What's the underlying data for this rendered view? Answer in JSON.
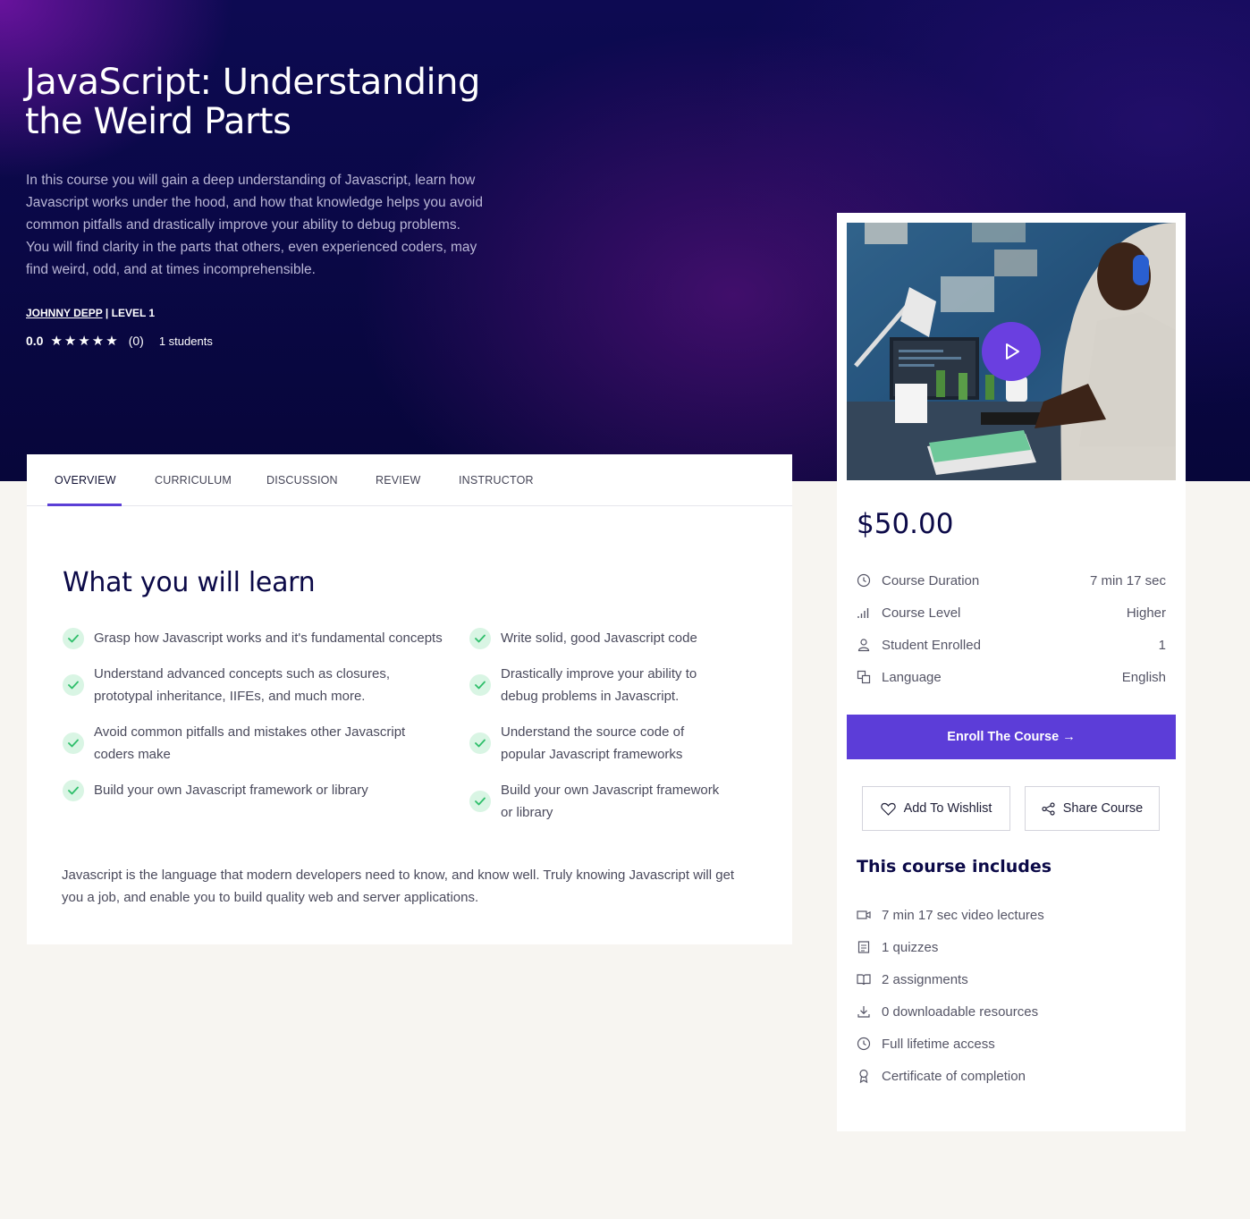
{
  "course": {
    "title": "JavaScript: Understanding the Weird Parts",
    "description": "In this course you will gain a deep understanding of Javascript, learn how Javascript works under the hood, and how that knowledge helps you avoid common pitfalls and drastically improve your ability to debug problems. You will find clarity in the parts that others, even experienced coders, may find weird, odd, and at times incomprehensible.",
    "author": "JOHNNY DEPP",
    "separator": " | ",
    "level": "LEVEL 1",
    "rating": "0.0",
    "stars": "★★★★★",
    "rating_count": "(0)",
    "students": "1 students"
  },
  "tabs": [
    "OVERVIEW",
    "CURRICULUM",
    "DISCUSSION",
    "REVIEW",
    "INSTRUCTOR"
  ],
  "learn": {
    "title": "What you will learn",
    "items": [
      "Grasp how Javascript works and it's fundamental concepts",
      "Write solid, good Javascript code",
      "Understand advanced concepts such as closures, prototypal inheritance, IIFEs, and much more.",
      "Drastically improve your ability to debug problems in Javascript.",
      "Avoid common pitfalls and mistakes other Javascript coders make",
      "Understand the source code of popular Javascript frameworks",
      "Build your own Javascript framework or library",
      "Build your own Javascript framework or library"
    ],
    "footer": "Javascript is the language that modern developers need to know, and know well. Truly knowing Javascript will get you a job, and enable you to build quality web and server applications."
  },
  "sidebar": {
    "price": "$50.00",
    "info": [
      {
        "label": "Course Duration",
        "value": "7 min 17 sec",
        "icon": "clock-icon"
      },
      {
        "label": "Course Level",
        "value": "Higher",
        "icon": "level-bars-icon"
      },
      {
        "label": "Student Enrolled",
        "value": "1",
        "icon": "students-icon"
      },
      {
        "label": "Language",
        "value": "English",
        "icon": "language-icon"
      }
    ],
    "enroll_label": "Enroll The Course →",
    "wishlist_label": "Add To Wishlist",
    "share_label": "Share Course",
    "includes_title": "This course includes",
    "includes": [
      {
        "label": "7 min 17 sec video lectures",
        "icon": "video-icon"
      },
      {
        "label": "1 quizzes",
        "icon": "quiz-icon"
      },
      {
        "label": "2 assignments",
        "icon": "book-icon"
      },
      {
        "label": "0 downloadable resources",
        "icon": "download-icon"
      },
      {
        "label": "Full lifetime access",
        "icon": "clock-icon"
      },
      {
        "label": "Certificate of completion",
        "icon": "award-icon"
      }
    ]
  },
  "colors": {
    "accent": "#5c3dd8",
    "hero_dark": "#07063a",
    "heading": "#0c0a48",
    "check_bg": "#d9f5e4",
    "check": "#2fbf6b"
  }
}
